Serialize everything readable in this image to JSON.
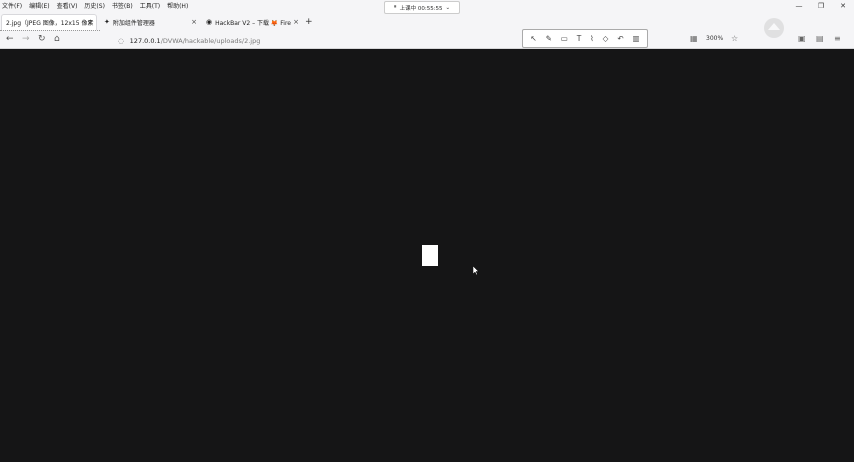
{
  "menu": [
    "文件(F)",
    "编辑(E)",
    "查看(V)",
    "历史(S)",
    "书签(B)",
    "工具(T)",
    "帮助(H)"
  ],
  "clock": {
    "text": "上课中 00:55:55",
    "icon": "pause-icon"
  },
  "tabs": [
    {
      "title": "2.jpg（JPEG 图像，12x15 像素",
      "close": "×"
    },
    {
      "title": "附加组件管理器",
      "close": "×"
    },
    {
      "title": "HackBar V2 – 下载 🦊 Fire",
      "close": "×"
    }
  ],
  "new_tab": "+",
  "url": {
    "host": "127.0.0.1",
    "path": "/DVWA/hackable/uploads/2.jpg"
  },
  "zoom": "300%",
  "window_controls": [
    "—",
    "❐",
    "✕"
  ],
  "colors": {
    "viewport_bg": "#151516",
    "chrome_bg": "#f5f5f7",
    "image_pixel": "#ffffff"
  }
}
